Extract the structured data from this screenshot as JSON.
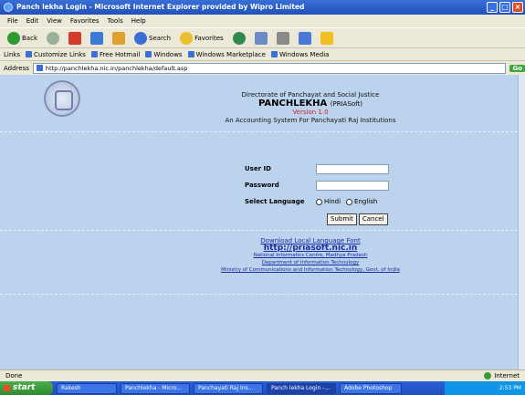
{
  "window": {
    "title": "Panch lekha Login - Microsoft Internet Explorer provided by Wipro Limited"
  },
  "menu": [
    "File",
    "Edit",
    "View",
    "Favorites",
    "Tools",
    "Help"
  ],
  "toolbar": {
    "back": "Back",
    "search": "Search",
    "favorites": "Favorites"
  },
  "links": {
    "label": "Links",
    "items": [
      "Customize Links",
      "Free Hotmail",
      "Windows",
      "Windows Marketplace",
      "Windows Media"
    ]
  },
  "address": {
    "label": "Address",
    "url": "http://panchlekha.nic.in/panchlekha/default.asp",
    "go": "Go"
  },
  "header": {
    "line1": "Directorate of Panchayat and Social Justice",
    "app": "PANCHLEKHA",
    "app_suffix": "(PRIASoft)",
    "version": "Version 1.0",
    "tagline": "An Accounting System For Panchayati Raj Institutions"
  },
  "form": {
    "user_label": "User ID",
    "password_label": "Password",
    "language_label": "Select Language",
    "hindi": "Hindi",
    "english": "English",
    "submit": "Submit",
    "cancel": "Cancel"
  },
  "footer": {
    "download": "Download Local Language Font",
    "details_prefix": "",
    "details_link": "http://priasoft.nic.in",
    "designed": "",
    "nic": "National Informatics Centre, Madhya Pradesh",
    "dept": "Department of Information Technology",
    "ministry": "Ministry of Communications and Information Technology, Govt. of India"
  },
  "status": {
    "left": "Done",
    "right": "Internet"
  },
  "taskbar": {
    "start": "start",
    "items": [
      "Rakesh",
      "Panchlekha - Micro...",
      "Panchayati Raj Ins...",
      "Panch lekha Login -...",
      "Adobe Photoshop"
    ],
    "clock": "2:53 PM"
  }
}
